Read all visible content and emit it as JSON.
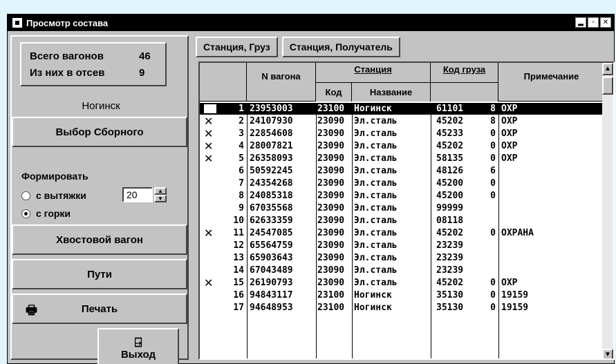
{
  "window": {
    "title": "Просмотр состава",
    "buttons": [
      "▂",
      "▫",
      "✕"
    ]
  },
  "left": {
    "total_label": "Всего вагонов",
    "total_value": "46",
    "excluded_label": "Из них в отсев",
    "excluded_value": "9",
    "station": "Ногинск",
    "choose_button": "Выбор Сборного",
    "form_label": "Формировать",
    "radio_pull": "с вытяжки",
    "radio_hump": "с горки",
    "pull_value": "20",
    "tail_button": "Хвостовой вагон",
    "tracks_button": "Пути",
    "print_button": "Печать",
    "exit_button": "Выход"
  },
  "tabs": [
    "Станция, Груз",
    "Станция, Получатель"
  ],
  "grid": {
    "headers": {
      "car": "N вагона",
      "station": "Станция",
      "code": "Код",
      "name": "Название",
      "cargo": "Код груза",
      "note": "Примечание"
    },
    "rows": [
      {
        "x": "",
        "n": "1",
        "car": "23953003",
        "code": "23100",
        "name": "Ногинск",
        "cargo": "61101",
        "flag": "8",
        "note": "ОХР",
        "selected": true
      },
      {
        "x": "✕",
        "n": "2",
        "car": "24107930",
        "code": "23090",
        "name": "Эл.сталь",
        "cargo": "45202",
        "flag": "8",
        "note": "ОХР",
        "selected": false
      },
      {
        "x": "✕",
        "n": "3",
        "car": "22854608",
        "code": "23090",
        "name": "Эл.сталь",
        "cargo": "45233",
        "flag": "0",
        "note": "ОХР",
        "selected": false
      },
      {
        "x": "✕",
        "n": "4",
        "car": "28007821",
        "code": "23090",
        "name": "Эл.сталь",
        "cargo": "45202",
        "flag": "0",
        "note": "ОХР",
        "selected": false
      },
      {
        "x": "✕",
        "n": "5",
        "car": "26358093",
        "code": "23090",
        "name": "Эл.сталь",
        "cargo": "58135",
        "flag": "0",
        "note": "ОХР",
        "selected": false
      },
      {
        "x": "",
        "n": "6",
        "car": "50592245",
        "code": "23090",
        "name": "Эл.сталь",
        "cargo": "48126",
        "flag": "6",
        "note": "",
        "selected": false
      },
      {
        "x": "",
        "n": "7",
        "car": "24354268",
        "code": "23090",
        "name": "Эл.сталь",
        "cargo": "45200",
        "flag": "0",
        "note": "",
        "selected": false
      },
      {
        "x": "",
        "n": "8",
        "car": "24085318",
        "code": "23090",
        "name": "Эл.сталь",
        "cargo": "45200",
        "flag": "0",
        "note": "",
        "selected": false
      },
      {
        "x": "",
        "n": "9",
        "car": "67035568",
        "code": "23090",
        "name": "Эл.сталь",
        "cargo": "99999",
        "flag": "",
        "note": "",
        "selected": false
      },
      {
        "x": "",
        "n": "10",
        "car": "62633359",
        "code": "23090",
        "name": "Эл.сталь",
        "cargo": "08118",
        "flag": "",
        "note": "",
        "selected": false
      },
      {
        "x": "✕",
        "n": "11",
        "car": "24547085",
        "code": "23090",
        "name": "Эл.сталь",
        "cargo": "45202",
        "flag": "0",
        "note": "ОХРАНА",
        "selected": false
      },
      {
        "x": "",
        "n": "12",
        "car": "65564759",
        "code": "23090",
        "name": "Эл.сталь",
        "cargo": "23239",
        "flag": "",
        "note": "",
        "selected": false
      },
      {
        "x": "",
        "n": "13",
        "car": "65903643",
        "code": "23090",
        "name": "Эл.сталь",
        "cargo": "23239",
        "flag": "",
        "note": "",
        "selected": false
      },
      {
        "x": "",
        "n": "14",
        "car": "67043489",
        "code": "23090",
        "name": "Эл.сталь",
        "cargo": "23239",
        "flag": "",
        "note": "",
        "selected": false
      },
      {
        "x": "✕",
        "n": "15",
        "car": "26190793",
        "code": "23090",
        "name": "Эл.сталь",
        "cargo": "45202",
        "flag": "0",
        "note": "ОХР",
        "selected": false
      },
      {
        "x": "",
        "n": "16",
        "car": "94843117",
        "code": "23100",
        "name": "Ногинск",
        "cargo": "35130",
        "flag": "0",
        "note": "19159",
        "selected": false
      },
      {
        "x": "",
        "n": "17",
        "car": "94648953",
        "code": "23100",
        "name": "Ногинск",
        "cargo": "35130",
        "flag": "0",
        "note": "19159",
        "selected": false
      }
    ]
  }
}
